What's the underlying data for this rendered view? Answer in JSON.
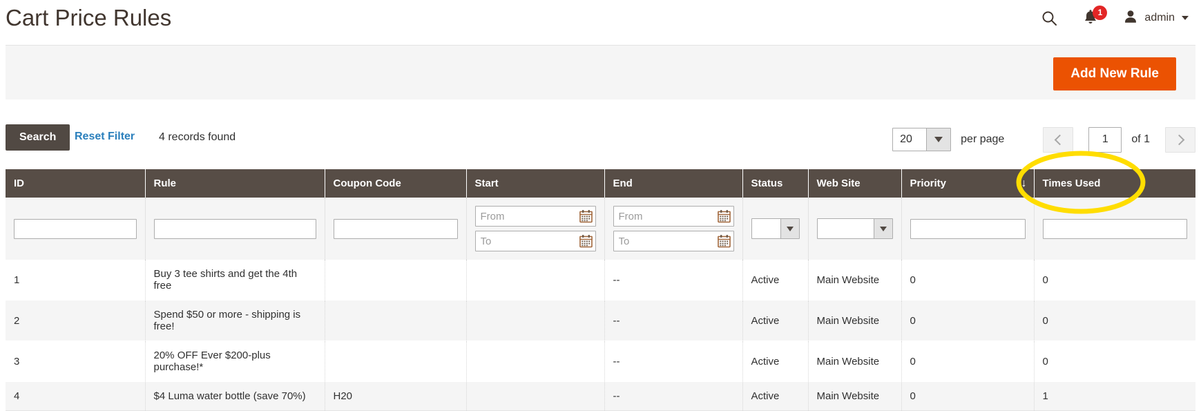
{
  "header": {
    "title": "Cart Price Rules",
    "search_icon": "search-icon",
    "notification_icon": "bell-icon",
    "notification_count": "1",
    "user_icon": "user-avatar-icon",
    "user_name": "admin",
    "user_caret": "chevron-down-icon"
  },
  "action_band": {
    "add_new_rule_label": "Add New Rule"
  },
  "toolbar": {
    "search_label": "Search",
    "reset_filter_label": "Reset Filter",
    "records_found": "4 records found",
    "per_page_value": "20",
    "per_page_label": "per page",
    "prev_icon": "chevron-left-icon",
    "next_icon": "chevron-right-icon",
    "page_value": "1",
    "of_total": "of 1"
  },
  "grid": {
    "columns": [
      {
        "key": "id",
        "label": "ID"
      },
      {
        "key": "rule",
        "label": "Rule"
      },
      {
        "key": "coupon_code",
        "label": "Coupon Code"
      },
      {
        "key": "start",
        "label": "Start"
      },
      {
        "key": "end",
        "label": "End"
      },
      {
        "key": "status",
        "label": "Status"
      },
      {
        "key": "web_site",
        "label": "Web Site"
      },
      {
        "key": "priority",
        "label": "Priority",
        "sort": "↓"
      },
      {
        "key": "times_used",
        "label": "Times Used"
      }
    ],
    "filters": {
      "id": "",
      "rule": "",
      "coupon_code": "",
      "start_from_placeholder": "From",
      "start_to_placeholder": "To",
      "start_from": "",
      "start_to": "",
      "end_from_placeholder": "From",
      "end_to_placeholder": "To",
      "end_from": "",
      "end_to": "",
      "status": "",
      "web_site": "",
      "priority": "",
      "times_used": ""
    },
    "rows": [
      {
        "id": "1",
        "rule": "Buy 3 tee shirts and get the 4th free",
        "coupon_code": "",
        "start": "",
        "end": "--",
        "status": "Active",
        "web_site": "Main Website",
        "priority": "0",
        "times_used": "0"
      },
      {
        "id": "2",
        "rule": "Spend $50 or more - shipping is free!",
        "coupon_code": "",
        "start": "",
        "end": "--",
        "status": "Active",
        "web_site": "Main Website",
        "priority": "0",
        "times_used": "0"
      },
      {
        "id": "3",
        "rule": "20% OFF Ever $200-plus purchase!*",
        "coupon_code": "",
        "start": "",
        "end": "--",
        "status": "Active",
        "web_site": "Main Website",
        "priority": "0",
        "times_used": "0"
      },
      {
        "id": "4",
        "rule": "$4 Luma water bottle (save 70%)",
        "coupon_code": "H20",
        "start": "",
        "end": "--",
        "status": "Active",
        "web_site": "Main Website",
        "priority": "0",
        "times_used": "1"
      }
    ]
  },
  "annotation": {
    "shape": "ellipse",
    "color": "#ffdd00",
    "target": "Times Used"
  },
  "colors": {
    "accent_orange": "#eb5202",
    "header_brown": "#574d46",
    "button_brown": "#514943",
    "link_blue": "#2a7fbc",
    "badge_red": "#e22626",
    "band_gray": "#f5f5f5",
    "annotation_yellow": "#ffdd00"
  }
}
